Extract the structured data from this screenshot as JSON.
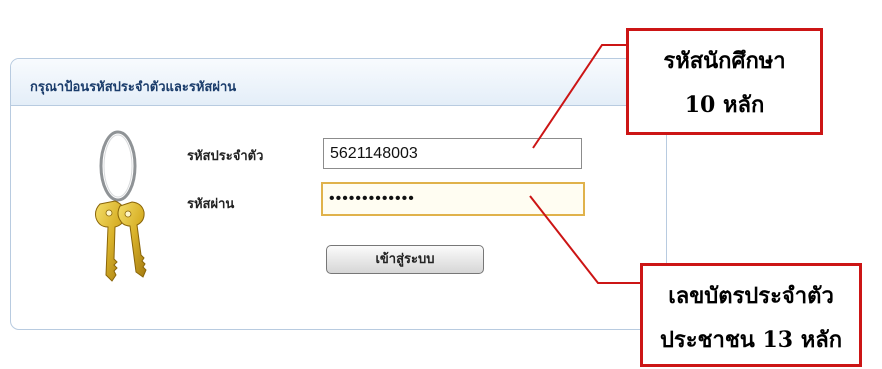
{
  "panel": {
    "title": "กรุณาป้อนรหัสประจำตัวและรหัสผ่าน"
  },
  "form": {
    "student_id_label": "รหัสประจำตัว",
    "student_id_value": "5621148003",
    "password_label": "รหัสผ่าน",
    "password_mask": "•••••••••••••",
    "login_button_label": "เข้าสู่ระบบ"
  },
  "annotations": {
    "top_line1": "รหัสนักศึกษา",
    "top_line2": "10 หลัก",
    "bottom_line1": "เลขบัตรประจำตัว",
    "bottom_line2": "ประชาชน 13 หลัก"
  },
  "colors": {
    "panel_border": "#b8cbe0",
    "panel_title": "#1a3c6b",
    "callout_border": "#cc1515",
    "focus_border": "#e0b24b"
  },
  "icons": [
    "keys-icon"
  ]
}
